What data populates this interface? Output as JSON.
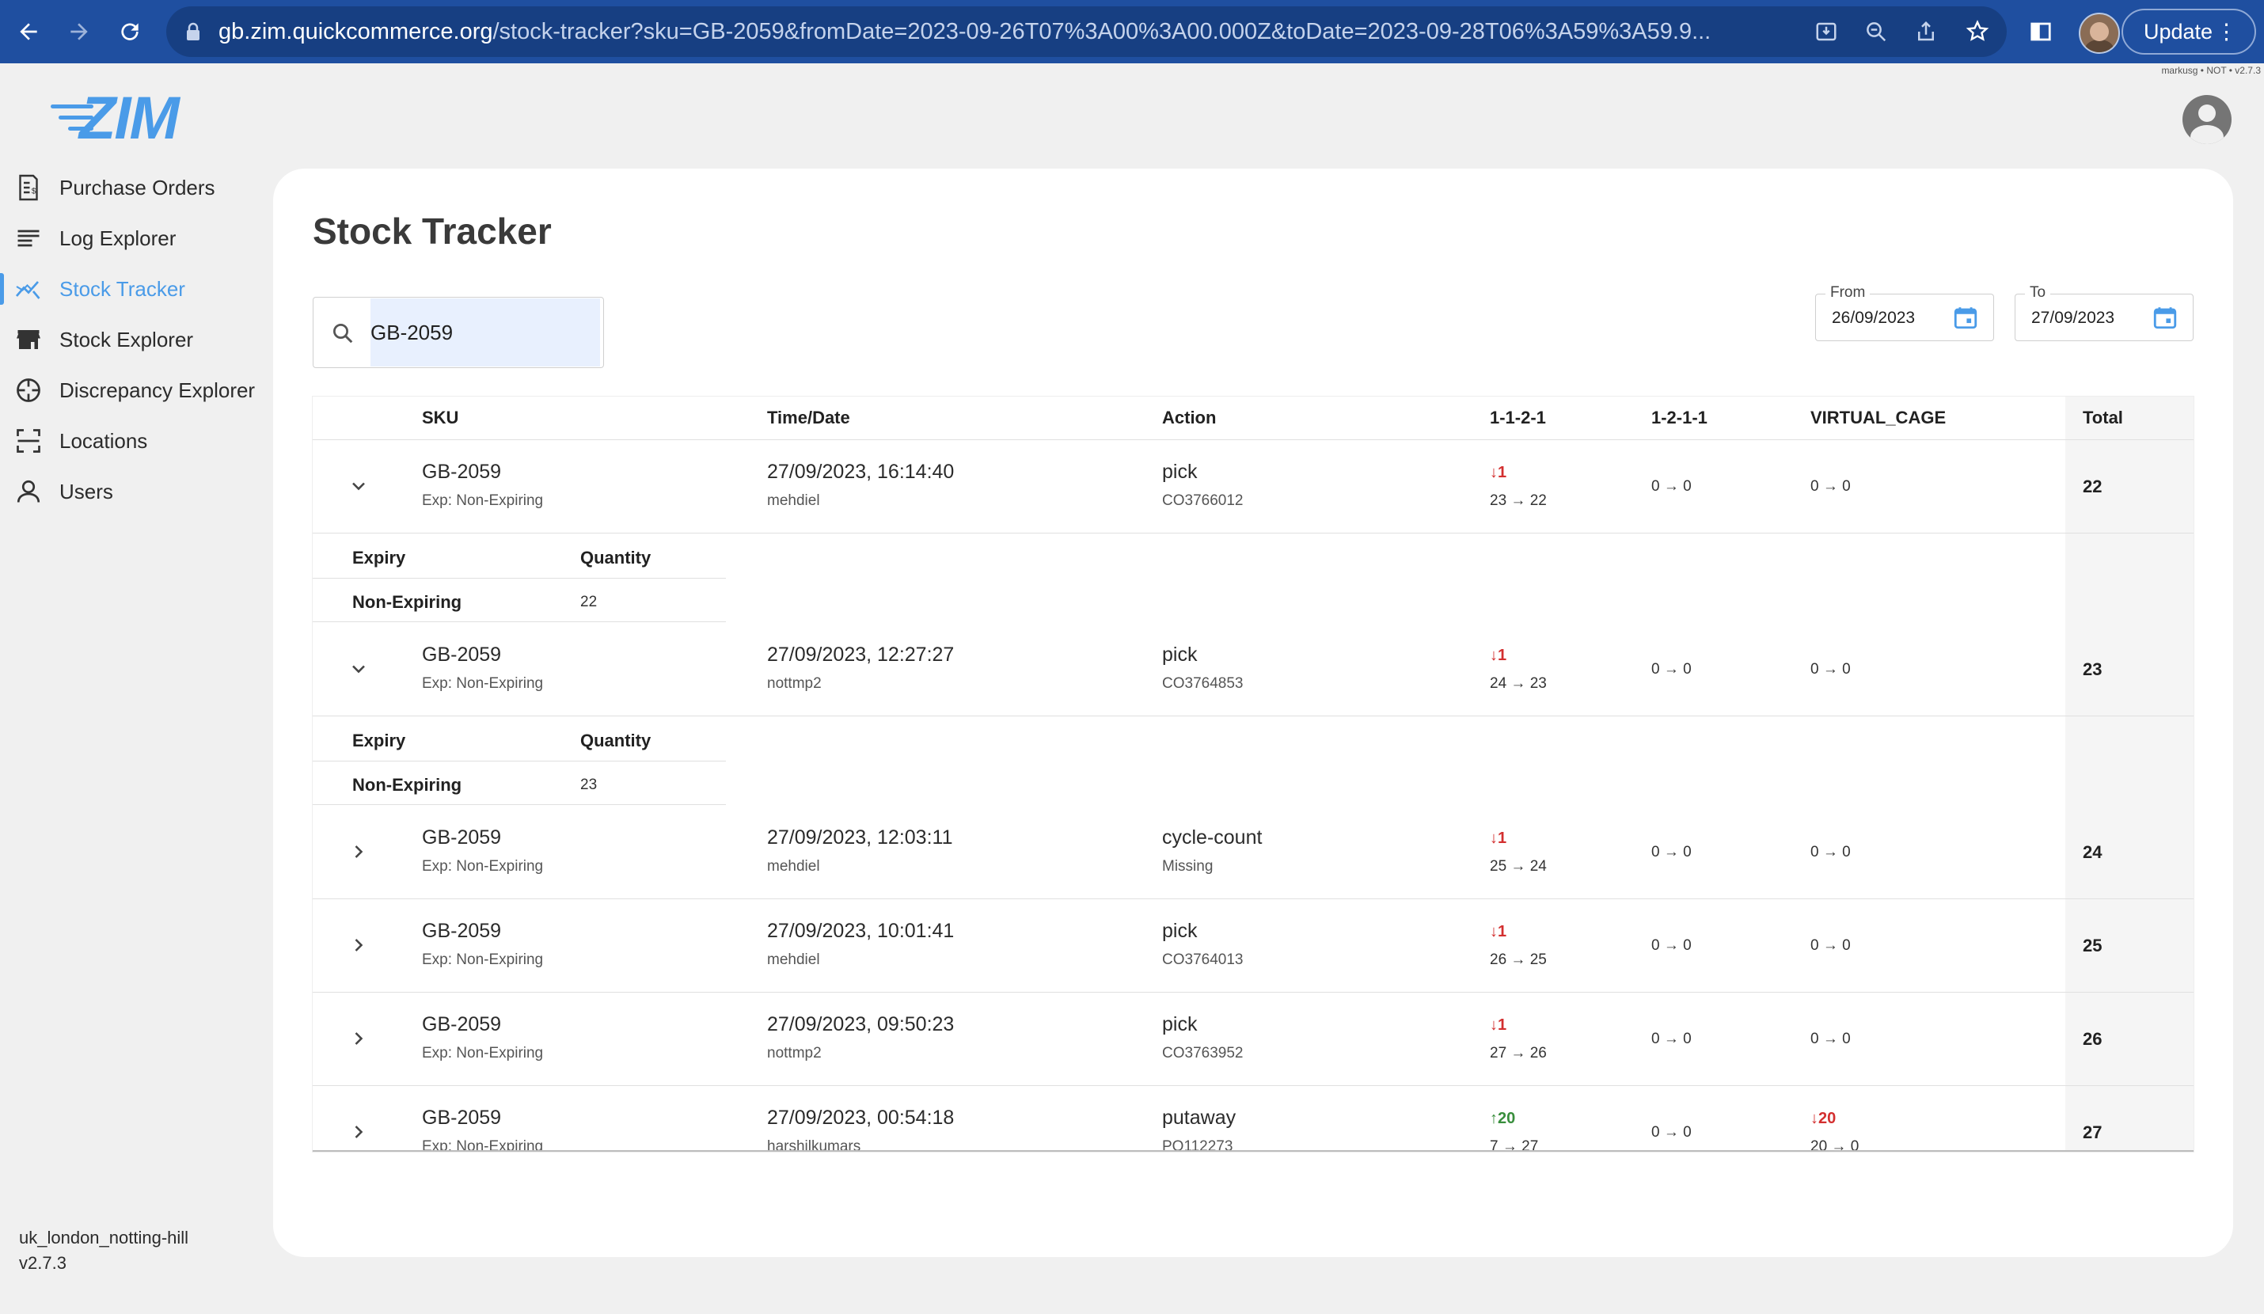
{
  "browser": {
    "url_host": "gb.zim.quickcommerce.org",
    "url_rest": "/stock-tracker?sku=GB-2059&fromDate=2023-09-26T07%3A00%3A00.000Z&toDate=2023-09-28T06%3A59%3A59.9...",
    "update_label": "Update",
    "version_tag": "markusg • NOT • v2.7.3"
  },
  "app": {
    "logo_text": "ZIM",
    "title": "Stock Tracker"
  },
  "sidebar": {
    "items": [
      {
        "label": "Purchase Orders",
        "icon": "receipt-icon",
        "active": false
      },
      {
        "label": "Log Explorer",
        "icon": "list-icon",
        "active": false
      },
      {
        "label": "Stock Tracker",
        "icon": "chart-line-icon",
        "active": true
      },
      {
        "label": "Stock Explorer",
        "icon": "store-icon",
        "active": false
      },
      {
        "label": "Discrepancy Explorer",
        "icon": "crosshair-icon",
        "active": false
      },
      {
        "label": "Locations",
        "icon": "scan-frame-icon",
        "active": false
      },
      {
        "label": "Users",
        "icon": "person-icon",
        "active": false
      }
    ],
    "footer_site": "uk_london_notting-hill",
    "footer_version": "v2.7.3"
  },
  "search": {
    "value": "GB-2059"
  },
  "filters": {
    "from_label": "From",
    "from_value": "26/09/2023",
    "to_label": "To",
    "to_value": "27/09/2023"
  },
  "table": {
    "columns": [
      "SKU",
      "Time/Date",
      "Action",
      "1-1-2-1",
      "1-2-1-1",
      "VIRTUAL_CAGE",
      "Total"
    ],
    "rows": [
      {
        "sku": "GB-2059",
        "exp": "Exp: Non-Expiring",
        "time": "27/09/2023, 16:14:40",
        "user": "mehdiel",
        "action": "pick",
        "ref": "CO3766012",
        "loc1_delta": "1",
        "loc1_dir": "down",
        "loc1_change": "23 → 22",
        "loc2": "0 → 0",
        "cage_delta": "",
        "cage_dir": "",
        "cage_change": "0 → 0",
        "total": "22",
        "expanded": true,
        "expiry_header": "Expiry",
        "qty_header": "Quantity",
        "expiry_value": "Non-Expiring",
        "qty_value": "22"
      },
      {
        "sku": "GB-2059",
        "exp": "Exp: Non-Expiring",
        "time": "27/09/2023, 12:27:27",
        "user": "nottmp2",
        "action": "pick",
        "ref": "CO3764853",
        "loc1_delta": "1",
        "loc1_dir": "down",
        "loc1_change": "24 → 23",
        "loc2": "0 → 0",
        "cage_delta": "",
        "cage_dir": "",
        "cage_change": "0 → 0",
        "total": "23",
        "expanded": true,
        "expiry_header": "Expiry",
        "qty_header": "Quantity",
        "expiry_value": "Non-Expiring",
        "qty_value": "23"
      },
      {
        "sku": "GB-2059",
        "exp": "Exp: Non-Expiring",
        "time": "27/09/2023, 12:03:11",
        "user": "mehdiel",
        "action": "cycle-count",
        "ref": "Missing",
        "loc1_delta": "1",
        "loc1_dir": "down",
        "loc1_change": "25 → 24",
        "loc2": "0 → 0",
        "cage_delta": "",
        "cage_dir": "",
        "cage_change": "0 → 0",
        "total": "24",
        "expanded": false
      },
      {
        "sku": "GB-2059",
        "exp": "Exp: Non-Expiring",
        "time": "27/09/2023, 10:01:41",
        "user": "mehdiel",
        "action": "pick",
        "ref": "CO3764013",
        "loc1_delta": "1",
        "loc1_dir": "down",
        "loc1_change": "26 → 25",
        "loc2": "0 → 0",
        "cage_delta": "",
        "cage_dir": "",
        "cage_change": "0 → 0",
        "total": "25",
        "expanded": false
      },
      {
        "sku": "GB-2059",
        "exp": "Exp: Non-Expiring",
        "time": "27/09/2023, 09:50:23",
        "user": "nottmp2",
        "action": "pick",
        "ref": "CO3763952",
        "loc1_delta": "1",
        "loc1_dir": "down",
        "loc1_change": "27 → 26",
        "loc2": "0 → 0",
        "cage_delta": "",
        "cage_dir": "",
        "cage_change": "0 → 0",
        "total": "26",
        "expanded": false
      },
      {
        "sku": "GB-2059",
        "exp": "Exp: Non-Expiring",
        "time": "27/09/2023, 00:54:18",
        "user": "harshilkumars",
        "action": "putaway",
        "ref": "PO112273",
        "loc1_delta": "20",
        "loc1_dir": "up",
        "loc1_change": "7 → 27",
        "loc2": "0 → 0",
        "cage_delta": "20",
        "cage_dir": "down",
        "cage_change": "20 → 0",
        "total": "27",
        "expanded": false
      }
    ]
  },
  "colors": {
    "accent": "#4a9be8",
    "chrome": "#1f4fa0",
    "delta_down": "#d32f2f",
    "delta_up": "#388e3c"
  }
}
